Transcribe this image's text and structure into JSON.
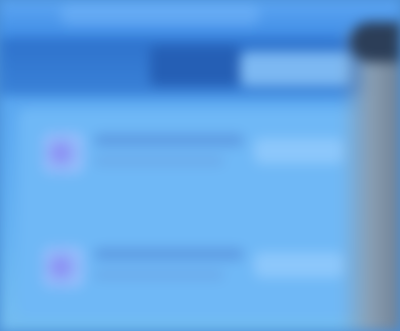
{
  "window": {
    "title": ""
  },
  "toolbar": {
    "label": ""
  },
  "list": {
    "items": [
      {
        "label": "",
        "description": "",
        "value": ""
      },
      {
        "label": "",
        "description": "",
        "value": ""
      }
    ]
  },
  "colors": {
    "accent": "#3d8ee8",
    "panel": "#6fb8f6",
    "icon_tint": "#8a7cf2"
  },
  "icons": {
    "item_icon": "app-icon"
  }
}
